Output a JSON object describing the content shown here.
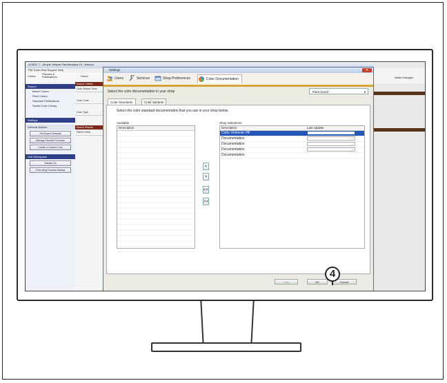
{
  "app": {
    "title": "ACBSC 7 - Simple Valspar PaintAnalysis 10 - Manual",
    "menu": "File  Tools  View  Support  Help",
    "toolbar": {
      "colors": "Colors",
      "pictures": "Pictures & Publications",
      "home": "Home",
      "user": "Wade Manager"
    },
    "left_nav": {
      "search_header": "Search",
      "tree_items": [
        "Match Colors",
        "Fleet Colors",
        "Standard Publications",
        "Saved Color Library"
      ],
      "settings_header": "Settings",
      "general_header": "General Actions",
      "buttons": [
        "Set Search Defaults",
        "Manage Favorite Formulas",
        "Create a Custom Color"
      ],
      "unit_header": "Unit Workspace",
      "unit_buttons": [
        "Sample On",
        "Print using Formula Markup"
      ]
    },
    "mid_col": {
      "header": "Search Criteria",
      "items": [
        "Color Search Tools",
        "Color Code",
        "Color Type"
      ],
      "header2": "Search Results",
      "result": "PAINTCODE"
    }
  },
  "dialog": {
    "title": "Settings",
    "tabs": [
      "Users",
      "Services",
      "Shop Preferences",
      "Color Documentation"
    ],
    "select_label": "Select the color documentation in your shop",
    "shop_value": "Paint brand",
    "subtabs": [
      "Color Standards",
      "Color Variants"
    ],
    "instruction": "Select the color standard documentation that you use in your shop below.",
    "available_label": "Available",
    "available_col": "Description",
    "shop_label": "Shop Selections",
    "shop_cols": [
      "Description",
      "Last Update"
    ],
    "shop_rows": [
      "Color Universe VR",
      "Documentation",
      "Documentation",
      "Documentation",
      "Documentation"
    ],
    "arrow_buttons": [
      "<",
      ">",
      "<<",
      ">>"
    ],
    "buttons": {
      "apply": "Help",
      "ok": "OK",
      "cancel": "Cancel"
    }
  },
  "callout": "4"
}
